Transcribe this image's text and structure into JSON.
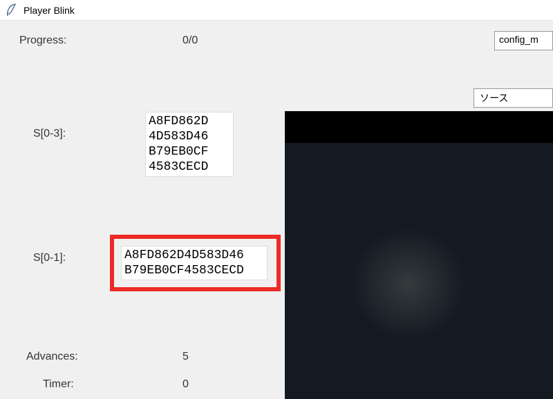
{
  "window": {
    "title": "Player Blink"
  },
  "labels": {
    "progress": "Progress:",
    "s03": "S[0-3]:",
    "s01": "S[0-1]:",
    "advances": "Advances:",
    "timer": "Timer:"
  },
  "values": {
    "progress": "0/0",
    "advances": "5",
    "timer": "0"
  },
  "seeds": {
    "s03": "A8FD862D\n4D583D46\nB79EB0CF\n4583CECD",
    "s01": "A8FD862D4D583D46\nB79EB0CF4583CECD"
  },
  "topright": {
    "config": "config_m",
    "source": "ソース"
  }
}
